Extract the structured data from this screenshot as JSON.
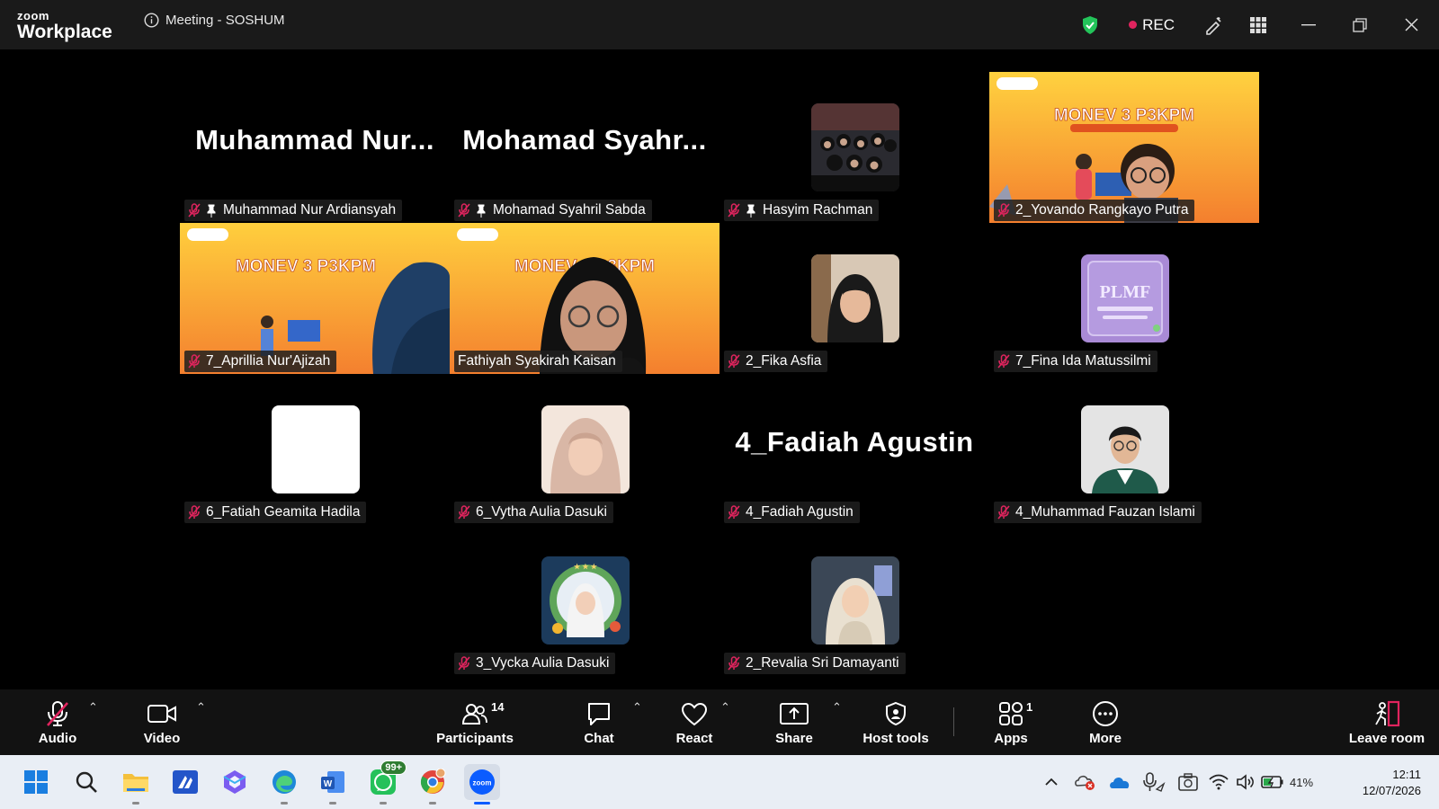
{
  "app": {
    "brand_small": "zoom",
    "brand_big": "Workplace",
    "meeting_title": "Meeting - SOSHUM",
    "rec_label": "REC"
  },
  "tiles": [
    {
      "label": "Muhammad Nur Ardiansyah",
      "big_name": "Muhammad  Nur...",
      "pinned": true,
      "muted": true,
      "kind": "name"
    },
    {
      "label": "Mohamad Syahril Sabda",
      "big_name": "Mohamad  Syahr...",
      "pinned": true,
      "muted": true,
      "kind": "name"
    },
    {
      "label": "Hasyim Rachman",
      "pinned": true,
      "muted": true,
      "kind": "avatar"
    },
    {
      "label": "2_Yovando Rangkayo Putra",
      "muted": true,
      "kind": "video",
      "banner": "MONEV 3 P3KPM"
    },
    {
      "label": "7_Aprillia Nur'Ajizah",
      "muted": true,
      "kind": "video",
      "banner": "MONEV 3 P3KPM"
    },
    {
      "label": "Fathiyah Syakirah Kaisan",
      "muted": false,
      "kind": "video",
      "banner": "MONEV 3 P3KPM",
      "active": true
    },
    {
      "label": "2_Fika Asfia",
      "muted": true,
      "kind": "avatar"
    },
    {
      "label": "7_Fina Ida Matussilmi",
      "muted": true,
      "kind": "avatar",
      "avatar_text": "PLMF"
    },
    {
      "label": "6_Fatiah Geamita Hadila",
      "muted": true,
      "kind": "avatar"
    },
    {
      "label": "6_Vytha Aulia Dasuki",
      "muted": true,
      "kind": "avatar"
    },
    {
      "label": "4_Fadiah Agustin",
      "big_name": "4_Fadiah Agustin",
      "muted": true,
      "kind": "name"
    },
    {
      "label": "4_Muhammad Fauzan Islami",
      "muted": true,
      "kind": "avatar"
    },
    {
      "label": "3_Vycka Aulia Dasuki",
      "muted": true,
      "kind": "avatar"
    },
    {
      "label": "2_Revalia Sri Damayanti",
      "muted": true,
      "kind": "avatar"
    }
  ],
  "toolbar": {
    "audio": "Audio",
    "video": "Video",
    "participants": "Participants",
    "participants_count": "14",
    "chat": "Chat",
    "react": "React",
    "share": "Share",
    "host_tools": "Host tools",
    "apps": "Apps",
    "apps_count": "1",
    "more": "More",
    "leave": "Leave room"
  },
  "taskbar": {
    "whatsapp_badge": "99+",
    "battery": "41%",
    "time": "12:11",
    "date": "12/07/2026"
  },
  "colors": {
    "active_border": "#23d96a",
    "mute_red": "#e0245e",
    "banner_orange": "#f7a23b"
  }
}
